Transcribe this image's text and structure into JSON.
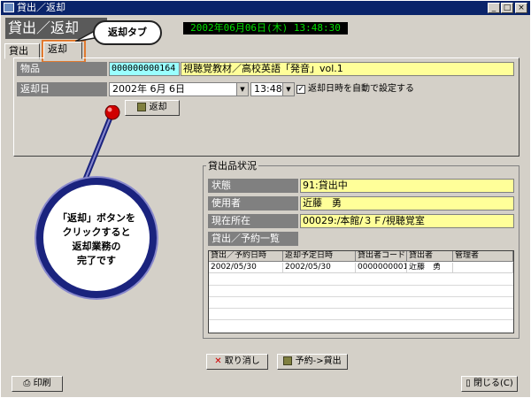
{
  "window": {
    "title": "貸出／返却"
  },
  "page_title": "貸出／返却",
  "clock": "2002年06月06日(木) 13:48:30",
  "callout_tab": "返却タブ",
  "tabs": [
    {
      "label": "貸出"
    },
    {
      "label": "返却"
    }
  ],
  "form": {
    "item_label": "物品",
    "item_code": "000000000164",
    "item_name": "視聴覚教材／高校英語「発音」vol.1",
    "return_date_label": "返却日",
    "date_value": "2002年  6月  6日",
    "time_value": "13:48",
    "auto_label": "返却日時を自動で設定する",
    "return_button": "返却"
  },
  "status": {
    "group_title": "貸出品状況",
    "state_label": "状態",
    "state_value": "91:貸出中",
    "user_label": "使用者",
    "user_value": "近藤　勇",
    "location_label": "現在所在",
    "location_value": "00029:/本館/３Ｆ/視聴覚室",
    "list_label": "貸出／予約一覧",
    "columns": [
      "貸出／予約日時",
      "返却予定日時",
      "貸出者コード",
      "貸出者",
      "管理者"
    ],
    "rows": [
      [
        "2002/05/30",
        "2002/05/30",
        "0000000001",
        "近藤　勇",
        ""
      ]
    ]
  },
  "callout_circle": [
    "「返却」ボタンを",
    "クリックすると",
    "返却業務の",
    "完了です"
  ],
  "footer": {
    "cancel_button": "取り消し",
    "reserve_button": "予約->貸出",
    "print_button": "印刷",
    "close_button": "閉じる(C)"
  },
  "colors": {
    "titlebar": "#0a246a",
    "yellow_field": "#ffff99",
    "cyan_field": "#99ffff",
    "clock_text": "#00e000",
    "callout_ring": "#1a237e"
  }
}
